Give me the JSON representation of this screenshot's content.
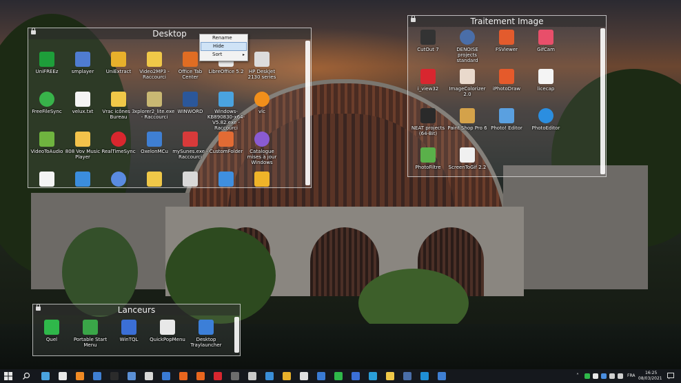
{
  "desktop_fence": {
    "title": "Desktop",
    "icons": [
      {
        "label": "UniFREEz",
        "color": "#1e9e3a",
        "icon": "unifreez-icon"
      },
      {
        "label": "smplayer",
        "color": "#4f7cd1",
        "icon": "smplayer-icon"
      },
      {
        "label": "UniExtract",
        "color": "#e8b02b",
        "icon": "box-icon"
      },
      {
        "label": "Video2MP3 - Raccourci",
        "color": "#f0c848",
        "icon": "folder-icon"
      },
      {
        "label": "Office Tab Center",
        "color": "#e06d23",
        "icon": "office-tab-icon"
      },
      {
        "label": "LibreOffice 5.2",
        "color": "#e9e9e9",
        "icon": "libreoffice-icon"
      },
      {
        "label": "HP DeskJet 2130 series",
        "color": "#dcdcdc",
        "icon": "printer-icon"
      },
      {
        "label": "FreeFileSync",
        "color": "#38b34a",
        "icon": "sync-icon"
      },
      {
        "label": "velux.txt",
        "color": "#f4f4f4",
        "icon": "text-file-icon"
      },
      {
        "label": "Vrac icônes 3 Bureau",
        "color": "#f0c848",
        "icon": "folder-icon"
      },
      {
        "label": "xplorer2_lite.exe - Raccourci",
        "color": "#c9b873",
        "icon": "xplorer-icon"
      },
      {
        "label": "WINWORD",
        "color": "#2b579a",
        "icon": "word-icon"
      },
      {
        "label": "Windows-KB890830-x64-V5.82.exe - Raccourci",
        "color": "#4aa3df",
        "icon": "windows-update-icon"
      },
      {
        "label": "vlc",
        "color": "#f18f1b",
        "icon": "vlc-icon"
      },
      {
        "label": "VideoToAudio",
        "color": "#6fb43f",
        "icon": "video-to-audio-icon"
      },
      {
        "label": "808 Vov Music Player",
        "color": "#f3c34b",
        "icon": "music-folder-icon"
      },
      {
        "label": "RealTimeSync",
        "color": "#d9272e",
        "icon": "realtimesync-icon"
      },
      {
        "label": "OxelonMCu",
        "color": "#3f7fd3",
        "icon": "oxelon-icon"
      },
      {
        "label": "mySunes.exe - Raccourci",
        "color": "#d83a3a",
        "icon": "camera-icon"
      },
      {
        "label": "CustomFolder",
        "color": "#e26b34",
        "icon": "customfolder-icon"
      },
      {
        "label": "Catalogue mises à jour Windows",
        "color": "#8a5bd1",
        "icon": "firefox-icon"
      },
      {
        "label": "",
        "color": "#f4f4f4",
        "icon": "document-icon"
      },
      {
        "label": "",
        "color": "#3b8ddd",
        "icon": "gear-icon"
      },
      {
        "label": "",
        "color": "#5a8be0",
        "icon": "disc-icon"
      },
      {
        "label": "",
        "color": "#f0c848",
        "icon": "folder-icon"
      },
      {
        "label": "",
        "color": "#d8d8d8",
        "icon": "drive-icon"
      },
      {
        "label": "",
        "color": "#3f8fe0",
        "icon": "bird-icon"
      },
      {
        "label": "",
        "color": "#f0b429",
        "icon": "window-icon"
      }
    ]
  },
  "context_menu": {
    "items": [
      {
        "label": "Rename"
      },
      {
        "label": "Hide"
      },
      {
        "label": "Sort",
        "arrow": "▸"
      }
    ]
  },
  "image_fence": {
    "title": "Traitement Image",
    "icons": [
      {
        "label": "CutOut 7",
        "color": "#333333",
        "icon": "scissors-icon"
      },
      {
        "label": "DENOISE projects standard",
        "color": "#4a6ea8",
        "icon": "camera-lens-icon"
      },
      {
        "label": "FSViewer",
        "color": "#e35b2d",
        "icon": "fsviewer-icon"
      },
      {
        "label": "GifCam",
        "color": "#e84f6a",
        "icon": "gifcam-icon"
      },
      {
        "label": "i_view32",
        "color": "#d8262f",
        "icon": "irfanview-icon"
      },
      {
        "label": "ImageColorizer 2.0",
        "color": "#e9d9cc",
        "icon": "portrait-icon"
      },
      {
        "label": "iPhotoDraw",
        "color": "#e55a2b",
        "icon": "iphotodraw-icon"
      },
      {
        "label": "licecap",
        "color": "#f4f4f4",
        "icon": "licecap-icon"
      },
      {
        "label": "NEAT projects (64-Bit)",
        "color": "#2a2a2a",
        "icon": "neat-icon"
      },
      {
        "label": "Paint Shop Pro 6",
        "color": "#d4a24a",
        "icon": "palette-icon"
      },
      {
        "label": "Photo! Editor",
        "color": "#5aa0e0",
        "icon": "photo-editor-icon"
      },
      {
        "label": "PhotoEditor",
        "color": "#2b8ee0",
        "icon": "color-wheel-icon"
      },
      {
        "label": "PhotoFiltre",
        "color": "#5ab04a",
        "icon": "photofiltre-icon"
      },
      {
        "label": "ScreenToGif 2.2",
        "color": "#f0f0f0",
        "icon": "screentogif-icon"
      }
    ]
  },
  "launcher_fence": {
    "title": "Lanceurs",
    "icons": [
      {
        "label": "Quel",
        "color": "#2fb84a",
        "icon": "grid-icon"
      },
      {
        "label": "Portable Start Menu",
        "color": "#3aa648",
        "icon": "upload-arrow-icon"
      },
      {
        "label": "WinTQL",
        "color": "#3b6fd6",
        "icon": "wintql-icon"
      },
      {
        "label": "QuickPopMenu",
        "color": "#e8e8e8",
        "icon": "quickpopmenu-icon"
      },
      {
        "label": "Desktop Traylauncher",
        "color": "#3c7fd8",
        "icon": "monitor-icon"
      }
    ]
  },
  "taskbar": {
    "language": "FRA",
    "time": "16:25",
    "date": "08/03/2021"
  }
}
